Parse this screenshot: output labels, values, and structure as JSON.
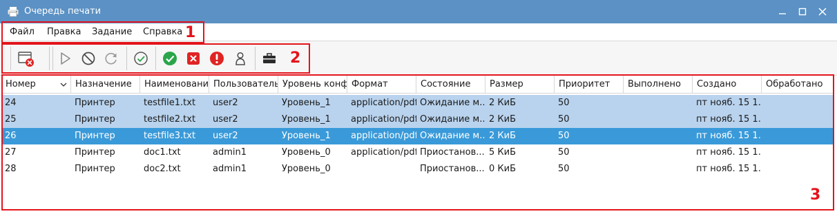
{
  "window": {
    "title": "Очередь печати",
    "accent_color": "#5b91c4",
    "controls": [
      "minimize-icon",
      "maximize-icon",
      "close-icon"
    ]
  },
  "menu": {
    "items": [
      "Файл",
      "Правка",
      "Задание",
      "Справка"
    ]
  },
  "toolbar": {
    "buttons": [
      "window-cancel-icon",
      "play-icon",
      "stop-icon",
      "refresh-icon",
      "check-circle-icon",
      "green-check-icon",
      "red-x-icon",
      "red-exclamation-icon",
      "person-icon",
      "toolbox-icon"
    ]
  },
  "annotations": {
    "menu_label": "1",
    "toolbar_label": "2",
    "table_label": "3",
    "color": "#e4131b"
  },
  "table": {
    "columns": [
      "Номер",
      "Назначение",
      "Наименовани",
      "Пользователь",
      "Уровень конф",
      "Формат",
      "Состояние",
      "Размер",
      "Приоритет",
      "Выполнено",
      "Создано",
      "Обработано"
    ],
    "rows": [
      {
        "number": "24",
        "destination": "Принтер",
        "name": "testfile1.txt",
        "user": "user2",
        "level": "Уровень_1",
        "format": "application/pdf",
        "state": "Ожидание м...",
        "size": "2 КиБ",
        "priority": "50",
        "completed": "",
        "created": "пт нояб. 15 1...",
        "processed": "",
        "selection": "light"
      },
      {
        "number": "25",
        "destination": "Принтер",
        "name": "testfile2.txt",
        "user": "user2",
        "level": "Уровень_1",
        "format": "application/pdf",
        "state": "Ожидание м...",
        "size": "2 КиБ",
        "priority": "50",
        "completed": "",
        "created": "пт нояб. 15 1...",
        "processed": "",
        "selection": "light"
      },
      {
        "number": "26",
        "destination": "Принтер",
        "name": "testfile3.txt",
        "user": "user2",
        "level": "Уровень_1",
        "format": "application/pdf",
        "state": "Ожидание м...",
        "size": "2 КиБ",
        "priority": "50",
        "completed": "",
        "created": "пт нояб. 15 1...",
        "processed": "",
        "selection": "active"
      },
      {
        "number": "27",
        "destination": "Принтер",
        "name": "doc1.txt",
        "user": "admin1",
        "level": "Уровень_0",
        "format": "application/pdf",
        "state": "Приостанов...",
        "size": "5 КиБ",
        "priority": "50",
        "completed": "",
        "created": "пт нояб. 15 1...",
        "processed": "",
        "selection": "none"
      },
      {
        "number": "28",
        "destination": "Принтер",
        "name": "doc2.txt",
        "user": "admin1",
        "level": "Уровень_0",
        "format": "",
        "state": "Приостанов...",
        "size": "0 КиБ",
        "priority": "50",
        "completed": "",
        "created": "пт нояб. 15 1...",
        "processed": "",
        "selection": "none"
      }
    ],
    "selection_colors": {
      "light": "#b9d3ee",
      "active": "#3a9ad9"
    }
  }
}
